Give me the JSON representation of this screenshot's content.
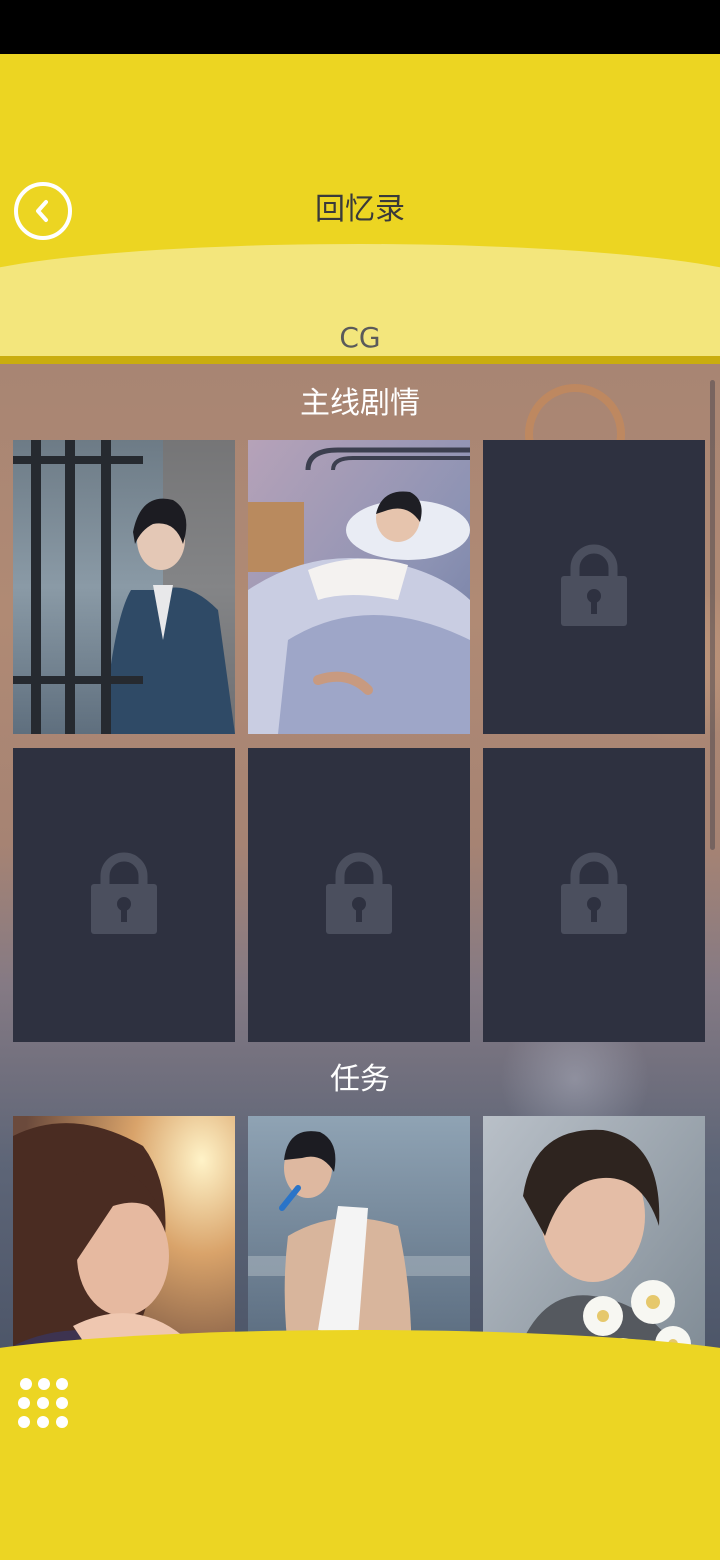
{
  "header": {
    "title": "回忆录",
    "tab": "CG",
    "back_icon": "chevron-left-icon"
  },
  "sections": [
    {
      "title": "主线剧情"
    },
    {
      "title": "任务"
    }
  ],
  "cards": {
    "main_story": [
      "unlocked",
      "unlocked",
      "locked",
      "locked",
      "locked",
      "locked"
    ],
    "tasks": [
      "unlocked",
      "unlocked",
      "unlocked"
    ]
  },
  "footer": {
    "menu_icon": "grid-dots-icon"
  },
  "colors": {
    "header_yellow": "#ecd522",
    "header_light": "#f3e67c",
    "locked_card": "#2e3140",
    "lock_glyph": "#4b4f5e"
  }
}
